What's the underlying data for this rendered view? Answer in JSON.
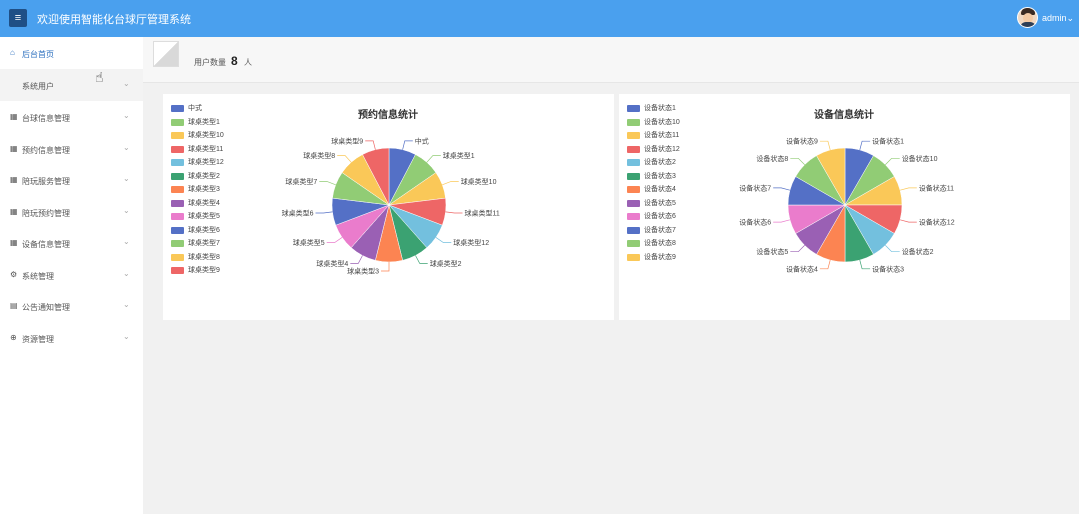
{
  "header": {
    "menu_icon": "≡",
    "title": "欢迎使用智能化台球厅管理系统",
    "user": "admin",
    "user_chevron": "⌄"
  },
  "sidebar": {
    "items": [
      {
        "label": "后台首页",
        "icon": "home-icon",
        "glyph": "⌂",
        "chevron": ""
      },
      {
        "label": "系统用户",
        "icon": "",
        "glyph": "",
        "chevron": "⌄"
      },
      {
        "label": "台球信息管理",
        "icon": "grid-icon",
        "glyph": "▦",
        "chevron": "⌄"
      },
      {
        "label": "预约信息管理",
        "icon": "grid-icon",
        "glyph": "▦",
        "chevron": "⌄"
      },
      {
        "label": "陪玩服务管理",
        "icon": "grid-icon",
        "glyph": "▦",
        "chevron": "⌄"
      },
      {
        "label": "陪玩预约管理",
        "icon": "grid-icon",
        "glyph": "▦",
        "chevron": "⌄"
      },
      {
        "label": "设备信息管理",
        "icon": "grid-icon",
        "glyph": "▦",
        "chevron": "⌄"
      },
      {
        "label": "系统管理",
        "icon": "gear-icon",
        "glyph": "⚙",
        "chevron": "⌄"
      },
      {
        "label": "公告通知管理",
        "icon": "document-icon",
        "glyph": "▤",
        "chevron": "⌄"
      },
      {
        "label": "资源管理",
        "icon": "plus-circle-icon",
        "glyph": "⊕",
        "chevron": "⌄"
      }
    ]
  },
  "stats": {
    "label": "用户数量",
    "value": "8",
    "unit": "人"
  },
  "colors": [
    "#5470c6",
    "#91cc75",
    "#fac858",
    "#ee6666",
    "#73c0de",
    "#3ba272",
    "#fc8452",
    "#9a60b4",
    "#ea7ccc"
  ],
  "chart_data": [
    {
      "type": "pie",
      "title": "预约信息统计",
      "legend": [
        "中式",
        "球桌类型1",
        "球桌类型10",
        "球桌类型11",
        "球桌类型12",
        "球桌类型2",
        "球桌类型3",
        "球桌类型4",
        "球桌类型5",
        "球桌类型6",
        "球桌类型7",
        "球桌类型8",
        "球桌类型9"
      ],
      "values": [
        1,
        1,
        1,
        1,
        1,
        1,
        1,
        1,
        1,
        1,
        1,
        1,
        1
      ],
      "labels": [
        "中式",
        "球桌类型1",
        "球桌类型10",
        "球桌类型11",
        "球桌类型12",
        "球桌类型2",
        "球桌类型3",
        "球桌类型4",
        "球桌类型5",
        "球桌类型6",
        "球桌类型7",
        "球桌类型8",
        "球桌类型9"
      ]
    },
    {
      "type": "pie",
      "title": "设备信息统计",
      "legend": [
        "设备状态1",
        "设备状态10",
        "设备状态11",
        "设备状态12",
        "设备状态2",
        "设备状态3",
        "设备状态4",
        "设备状态5",
        "设备状态6",
        "设备状态7",
        "设备状态8",
        "设备状态9"
      ],
      "values": [
        1,
        1,
        1,
        1,
        1,
        1,
        1,
        1,
        1,
        1,
        1,
        1
      ],
      "labels": [
        "设备状态1",
        "设备状态10",
        "设备状态11",
        "设备状态12",
        "设备状态2",
        "设备状态3",
        "设备状态4",
        "设备状态5",
        "设备状态6",
        "设备状态7",
        "设备状态8",
        "设备状态9"
      ]
    }
  ]
}
